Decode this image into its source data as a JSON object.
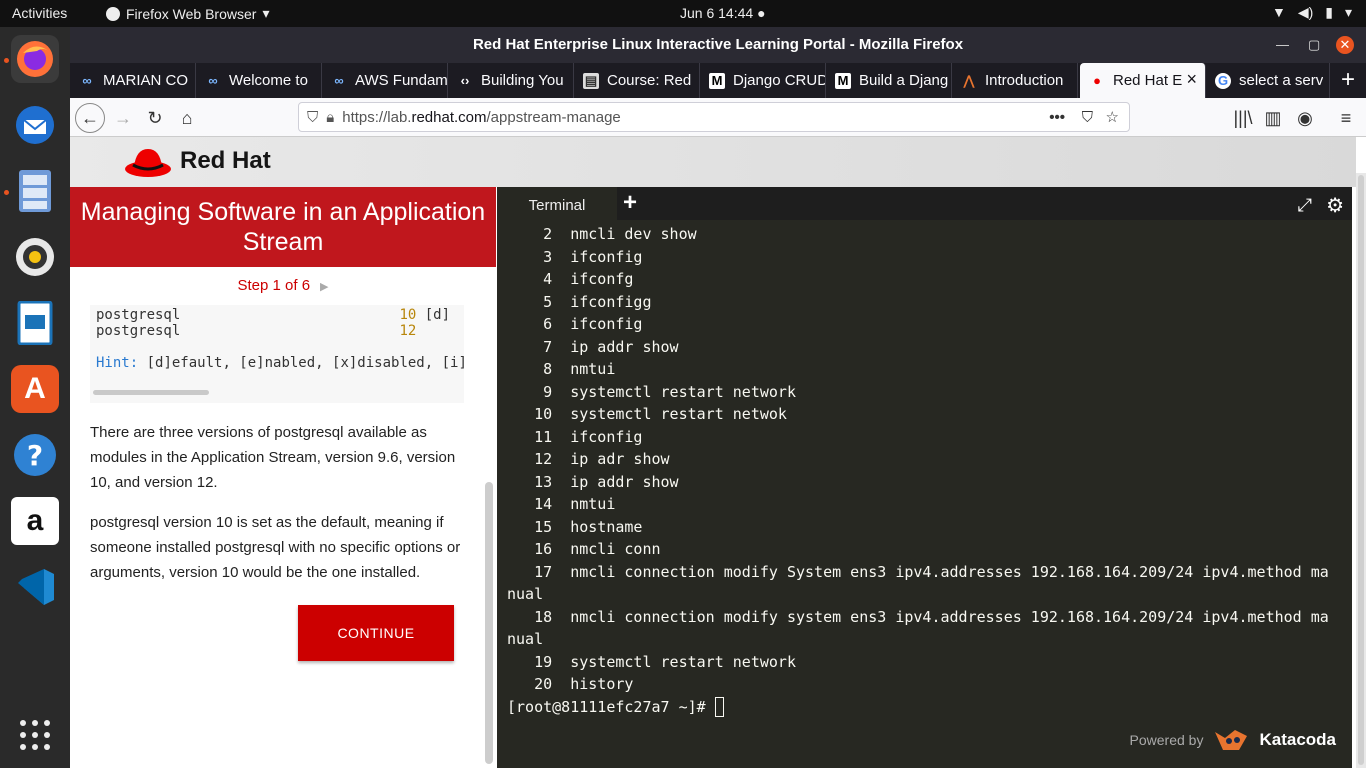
{
  "topbar": {
    "activities": "Activities",
    "app_name": "Firefox Web Browser",
    "clock": "Jun 6  14:44"
  },
  "window": {
    "title": "Red Hat Enterprise Linux Interactive Learning Portal - Mozilla Firefox"
  },
  "tabs": [
    {
      "label": "MARIAN CO",
      "icon": "infinity-icon"
    },
    {
      "label": "Welcome to",
      "icon": "infinity-icon"
    },
    {
      "label": "AWS Fundam",
      "icon": "infinity-icon"
    },
    {
      "label": "Building You",
      "icon": "code-icon"
    },
    {
      "label": "Course: Red",
      "icon": "course-icon"
    },
    {
      "label": "Django CRUD",
      "icon": "medium-icon"
    },
    {
      "label": "Build a Djang",
      "icon": "medium-icon"
    },
    {
      "label": "Introduction",
      "icon": "triangle-icon"
    },
    {
      "label": "Red Hat E",
      "icon": "redhat-icon"
    },
    {
      "label": "select a serv",
      "icon": "google-icon"
    }
  ],
  "urlbar": {
    "prefix": "https://lab.",
    "host": "redhat.com",
    "path": "/appstream-manage"
  },
  "header": {
    "logo_text": "Red Hat"
  },
  "lesson": {
    "title": "Managing Software in an Application Stream",
    "step": "Step 1 of 6",
    "code_rows": [
      {
        "name": "postgresql",
        "version": "10",
        "flag": " [d]"
      },
      {
        "name": "postgresql",
        "version": "12",
        "flag": ""
      }
    ],
    "hint_label": "Hint:",
    "hint_text": " [d]efault, [e]nabled, [x]disabled, [i]n",
    "para1": "There are three versions of postgresql available as modules in the Application Stream, version 9.6, version 10, and version 12.",
    "para2": "postgresql version 10 is set as the default, meaning if someone installed postgresql with no specific options or arguments, version 10 would be the one installed.",
    "continue": "CONTINUE"
  },
  "terminal": {
    "tab_label": "Terminal",
    "lines": [
      "    2  nmcli dev show",
      "    3  ifconfig",
      "    4  ifconfg",
      "    5  ifconfigg",
      "    6  ifconfig",
      "    7  ip addr show",
      "    8  nmtui",
      "    9  systemctl restart network",
      "   10  systemctl restart netwok",
      "   11  ifconfig",
      "   12  ip adr show",
      "   13  ip addr show",
      "   14  nmtui",
      "   15  hostname",
      "   16  nmcli conn",
      "   17  nmcli connection modify System ens3 ipv4.addresses 192.168.164.209/24 ipv4.method ma",
      "nual",
      "   18  nmcli connection modify system ens3 ipv4.addresses 192.168.164.209/24 ipv4.method ma",
      "nual",
      "   19  systemctl restart network",
      "   20  history"
    ],
    "prompt": "[root@81111efc27a7 ~]# ",
    "powered_by": "Powered by",
    "brand": "Katacoda"
  }
}
